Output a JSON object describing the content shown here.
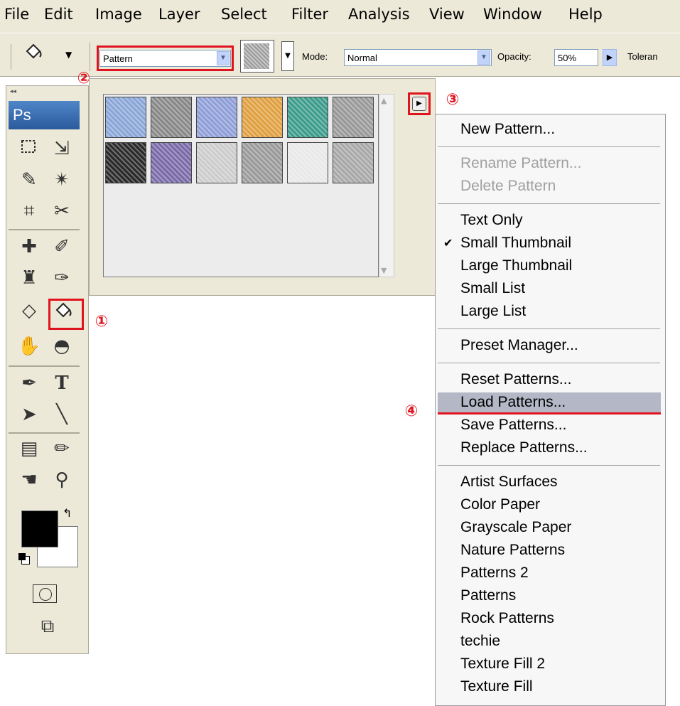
{
  "menubar": {
    "items": [
      {
        "label": "File",
        "name": "file"
      },
      {
        "label": "Edit",
        "name": "edit"
      },
      {
        "label": "Image",
        "name": "image"
      },
      {
        "label": "Layer",
        "name": "layer"
      },
      {
        "label": "Select",
        "name": "select"
      },
      {
        "label": "Filter",
        "name": "filter"
      },
      {
        "label": "Analysis",
        "name": "analysis"
      },
      {
        "label": "View",
        "name": "view"
      },
      {
        "label": "Window",
        "name": "window"
      },
      {
        "label": "Help",
        "name": "help"
      }
    ]
  },
  "options": {
    "fill_source": "Pattern",
    "mode_label": "Mode:",
    "mode_value": "Normal",
    "opacity_label": "Opacity:",
    "opacity_value": "50%",
    "tolerance_label": "Toleran"
  },
  "toolbox": {
    "logo": "Ps"
  },
  "annotations": {
    "one": "①",
    "two": "②",
    "three": "③",
    "four": "④"
  },
  "patterns": {
    "swatches": [
      {
        "name": "bubbles",
        "color": "#8aa6d8"
      },
      {
        "name": "wood-grain",
        "color": "#888888"
      },
      {
        "name": "blue-weave",
        "color": "#8e9ed8"
      },
      {
        "name": "orange-texture",
        "color": "#e0a040"
      },
      {
        "name": "rainbow-waves",
        "color": "#3c9c8c"
      },
      {
        "name": "gray-stone",
        "color": "#999999"
      },
      {
        "name": "checker",
        "color": "#2a2a2a"
      },
      {
        "name": "colorful-noise",
        "color": "#7a6aa8"
      },
      {
        "name": "clouds",
        "color": "#cccccc"
      },
      {
        "name": "noise-dots",
        "color": "#9a9a9a"
      },
      {
        "name": "chevron-stripe",
        "color": "#e8e8e8"
      },
      {
        "name": "gray-cloud",
        "color": "#a8a8a8"
      }
    ]
  },
  "context_menu": {
    "groups": [
      {
        "items": [
          {
            "label": "New Pattern...",
            "disabled": false
          }
        ]
      },
      {
        "items": [
          {
            "label": "Rename Pattern...",
            "disabled": true
          },
          {
            "label": "Delete Pattern",
            "disabled": true
          }
        ]
      },
      {
        "items": [
          {
            "label": "Text Only"
          },
          {
            "label": "Small Thumbnail",
            "checked": true
          },
          {
            "label": "Large Thumbnail"
          },
          {
            "label": "Small List"
          },
          {
            "label": "Large List"
          }
        ]
      },
      {
        "items": [
          {
            "label": "Preset Manager..."
          }
        ]
      },
      {
        "items": [
          {
            "label": "Reset Patterns..."
          },
          {
            "label": "Load Patterns...",
            "highlighted": true
          },
          {
            "label": "Save Patterns..."
          },
          {
            "label": "Replace Patterns..."
          }
        ]
      },
      {
        "items": [
          {
            "label": "Artist Surfaces"
          },
          {
            "label": "Color Paper"
          },
          {
            "label": "Grayscale Paper"
          },
          {
            "label": "Nature Patterns"
          },
          {
            "label": "Patterns 2"
          },
          {
            "label": "Patterns"
          },
          {
            "label": "Rock Patterns"
          },
          {
            "label": "techie"
          },
          {
            "label": "Texture Fill 2"
          },
          {
            "label": "Texture Fill"
          }
        ]
      }
    ],
    "check_glyph": "✔",
    "highlight_color": "#b4b8c6",
    "underline_color": "#e0141e"
  }
}
